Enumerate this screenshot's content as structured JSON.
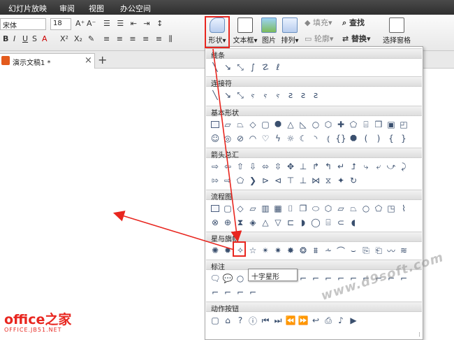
{
  "menubar": {
    "items": [
      "幻灯片放映",
      "审阅",
      "视图",
      "办公空间"
    ]
  },
  "ribbon": {
    "font_name": "宋体",
    "font_size": "18",
    "shapes_label": "形状",
    "textbox_label": "文本框",
    "picture_label": "图片",
    "arrange_label": "排列",
    "fill_label": "填充",
    "outline_label": "轮廓",
    "find_label": "查找",
    "replace_label": "替换",
    "selection_pane_label": "选择窗格"
  },
  "tabs": {
    "doc_title": "演示文稿1 *",
    "new_tab": "+",
    "close": "×"
  },
  "panel": {
    "sections": [
      "线条",
      "连接符",
      "基本形状",
      "箭头总汇",
      "流程图",
      "星与旗帜",
      "标注",
      "动作按钮"
    ]
  },
  "tooltip": "十字星形",
  "logo": {
    "text": "office之家",
    "sub": "OFFICE.JB51.NET"
  },
  "watermark": "www.d9soft.com",
  "colors": {
    "accent": "#e8261f",
    "logo": "#e8261f"
  }
}
